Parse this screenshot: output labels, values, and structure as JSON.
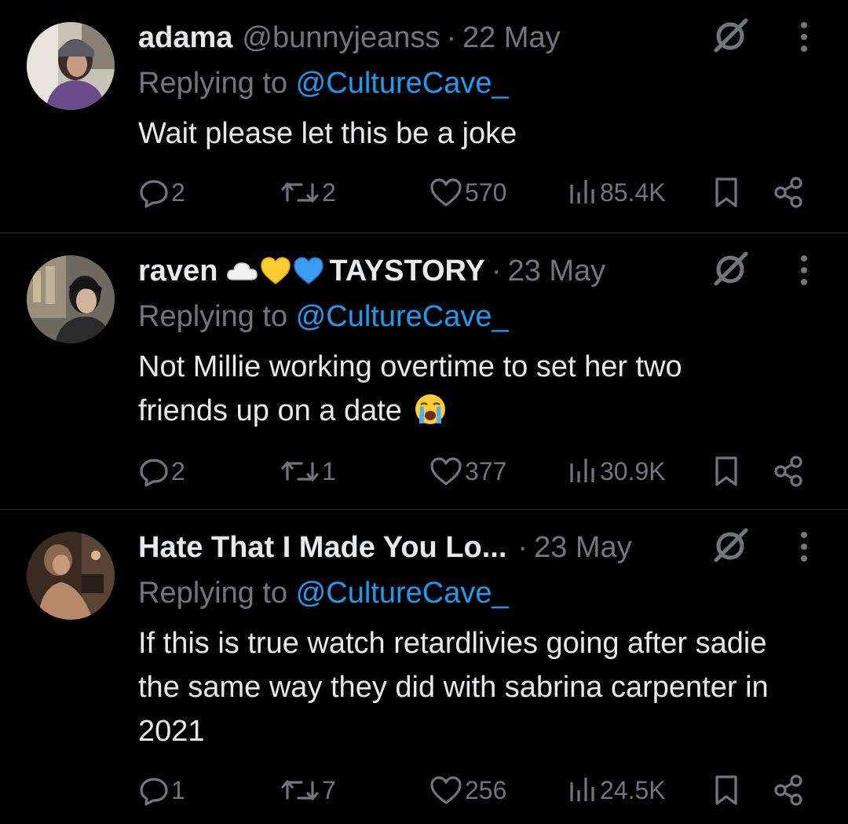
{
  "colors": {
    "background": "#000000",
    "primary_text": "#e7e9ea",
    "secondary_text": "#71767b",
    "mention": "#1d9bf0",
    "divider": "#2f3336"
  },
  "replies": [
    {
      "avatar": "avatar-photo",
      "name": "adama",
      "emojis": [],
      "handle": "@bunnyjeanss",
      "separator": "·",
      "date": "22 May",
      "replying_prefix": "Replying to ",
      "replying_to": "@CultureCave_",
      "text": "Wait please let this be a joke",
      "text_emoji": "",
      "replies": "2",
      "reposts": "2",
      "likes": "570",
      "views": "85.4K"
    },
    {
      "avatar": "avatar-photo",
      "name": "raven",
      "emojis": [
        "cloud-emoji",
        "yellow-heart-emoji",
        "blue-heart-emoji"
      ],
      "handle": "TAYSTORY",
      "separator": "·",
      "date": "23 May",
      "replying_prefix": "Replying to ",
      "replying_to": "@CultureCave_",
      "text": "Not Millie working overtime to set her two friends up on a date",
      "text_emoji": "loudly-crying-face-emoji",
      "replies": "2",
      "reposts": "1",
      "likes": "377",
      "views": "30.9K"
    },
    {
      "avatar": "avatar-photo",
      "name": "Hate That I Made You Lo...",
      "emojis": [],
      "handle": "",
      "separator": "·",
      "date": "23 May",
      "replying_prefix": "Replying to ",
      "replying_to": "@CultureCave_",
      "text": "If this is true watch retardlivies going after sadie the same way they did with sabrina carpenter in 2021",
      "text_emoji": "",
      "replies": "1",
      "reposts": "7",
      "likes": "256",
      "views": "24.5K"
    }
  ],
  "icons": {
    "reply": "comment-icon",
    "repost": "repost-icon",
    "like": "heart-icon",
    "views": "views-chart-icon",
    "bookmark": "bookmark-icon",
    "share": "share-icon",
    "grok": "grok-icon",
    "more": "more-vertical-icon"
  }
}
